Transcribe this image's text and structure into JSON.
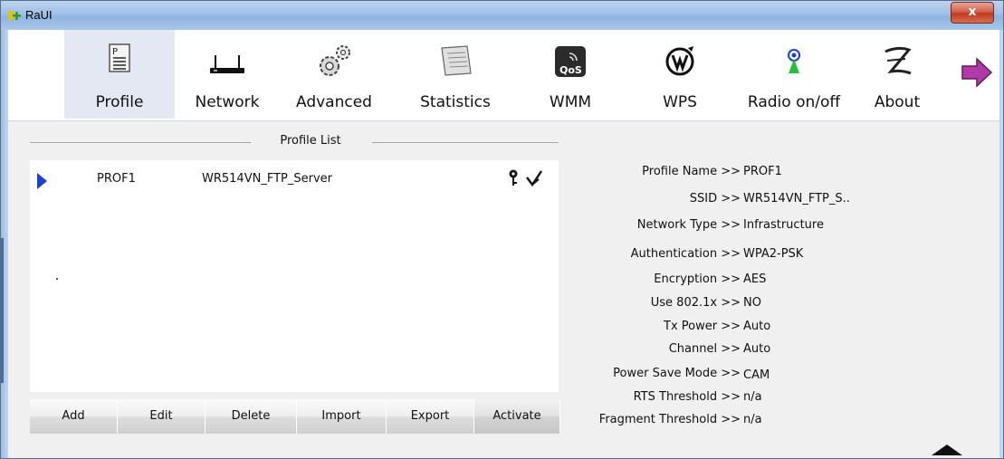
{
  "window": {
    "title": "RaUI",
    "close_glyph": "x",
    "accent": "#1a3ee0"
  },
  "toolbar": {
    "items": [
      {
        "label": "Profile",
        "icon": "profile-icon",
        "active": true
      },
      {
        "label": "Network",
        "icon": "network-icon"
      },
      {
        "label": "Advanced",
        "icon": "advanced-gears-icon"
      },
      {
        "label": "Statistics",
        "icon": "statistics-icon"
      },
      {
        "label": "WMM",
        "icon": "wmm-qos-icon"
      },
      {
        "label": "WPS",
        "icon": "wps-icon"
      },
      {
        "label": "Radio on/off",
        "icon": "radio-icon"
      },
      {
        "label": "About",
        "icon": "about-icon"
      }
    ],
    "more_icon": "next-arrow-icon"
  },
  "profile_list": {
    "title": "Profile List",
    "rows": [
      {
        "name": "PROF1",
        "ssid": "WR514VN_FTP_Server",
        "status_icons": [
          "key-icon",
          "signal-icon"
        ]
      }
    ]
  },
  "buttons": {
    "add": "Add",
    "edit": "Edit",
    "delete": "Delete",
    "import": "Import",
    "export": "Export",
    "activate": "Activate"
  },
  "details": [
    {
      "key": "Profile Name >>",
      "value": "PROF1"
    },
    {
      "key": "SSID >>",
      "value": "WR514VN_FTP_S.."
    },
    {
      "key": "Network Type >>",
      "value": "Infrastructure"
    },
    {
      "key": "Authentication >>",
      "value": "WPA2-PSK"
    },
    {
      "key": "Encryption >>",
      "value": "AES"
    },
    {
      "key": "Use 802.1x >>",
      "value": "NO"
    },
    {
      "key": "Tx Power >>",
      "value": "Auto"
    },
    {
      "key": "Channel >>",
      "value": "Auto"
    },
    {
      "key": "Power Save Mode >>",
      "value": "CAM"
    },
    {
      "key": "RTS Threshold >>",
      "value": "n/a"
    },
    {
      "key": "Fragment Threshold >>",
      "value": "n/a"
    }
  ]
}
